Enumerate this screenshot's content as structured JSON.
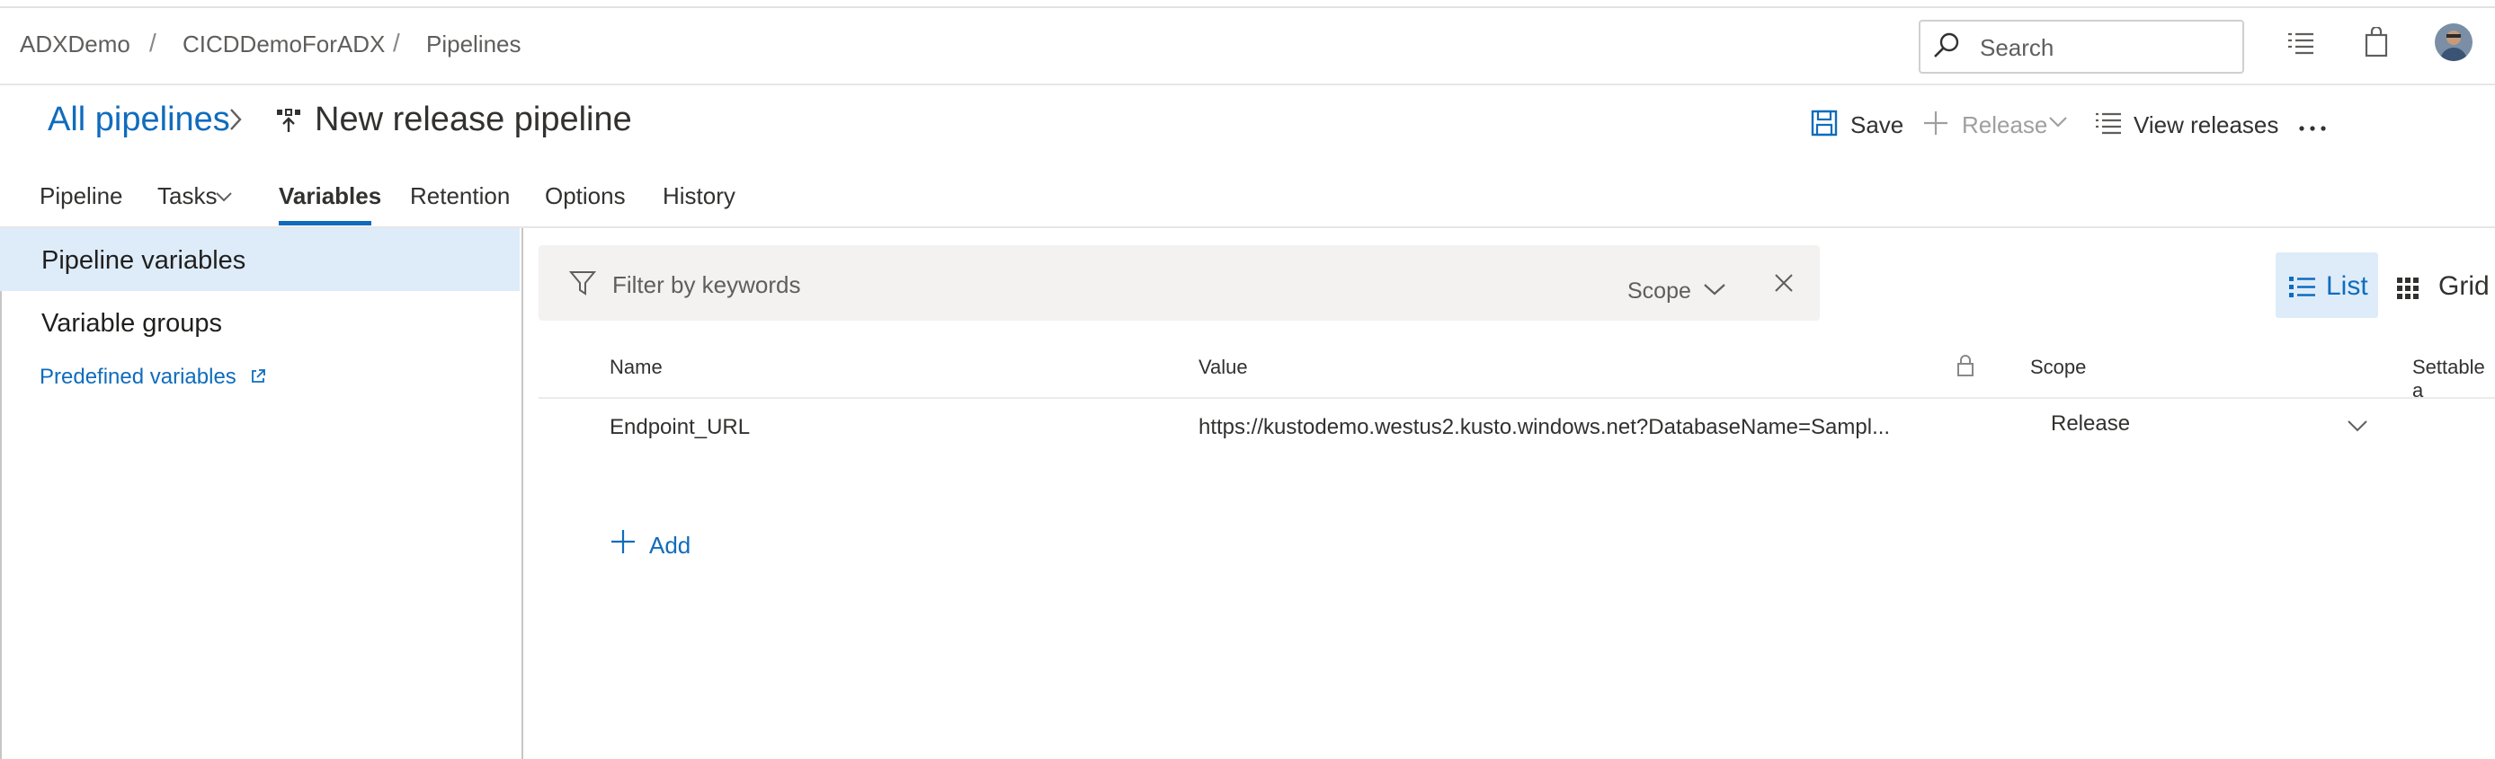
{
  "header": {
    "breadcrumb": [
      "ADXDemo",
      "CICDDemoForADX",
      "Pipelines"
    ],
    "search_placeholder": "Search"
  },
  "titlebar": {
    "back_link": "All pipelines",
    "title": "New release pipeline",
    "commands": {
      "save": "Save",
      "release": "Release",
      "view_releases": "View releases"
    }
  },
  "tabs": [
    "Pipeline",
    "Tasks",
    "Variables",
    "Retention",
    "Options",
    "History"
  ],
  "active_tab": "Variables",
  "sidebar": {
    "items": [
      "Pipeline variables",
      "Variable groups"
    ],
    "selected": "Pipeline variables",
    "link": "Predefined variables"
  },
  "filter": {
    "placeholder": "Filter by keywords",
    "scope_label": "Scope"
  },
  "view_toggle": {
    "list": "List",
    "grid": "Grid",
    "selected": "List"
  },
  "table": {
    "columns": [
      "Name",
      "Value",
      "Scope",
      "Settable a"
    ],
    "rows": [
      {
        "name": "Endpoint_URL",
        "value": "https://kustodemo.westus2.kusto.windows.net?DatabaseName=Sampl...",
        "scope": "Release"
      }
    ],
    "add_label": "Add"
  },
  "colors": {
    "accent": "#0f6cbd",
    "selected_bg": "#deecf9",
    "filter_bg": "#f3f2f1"
  }
}
